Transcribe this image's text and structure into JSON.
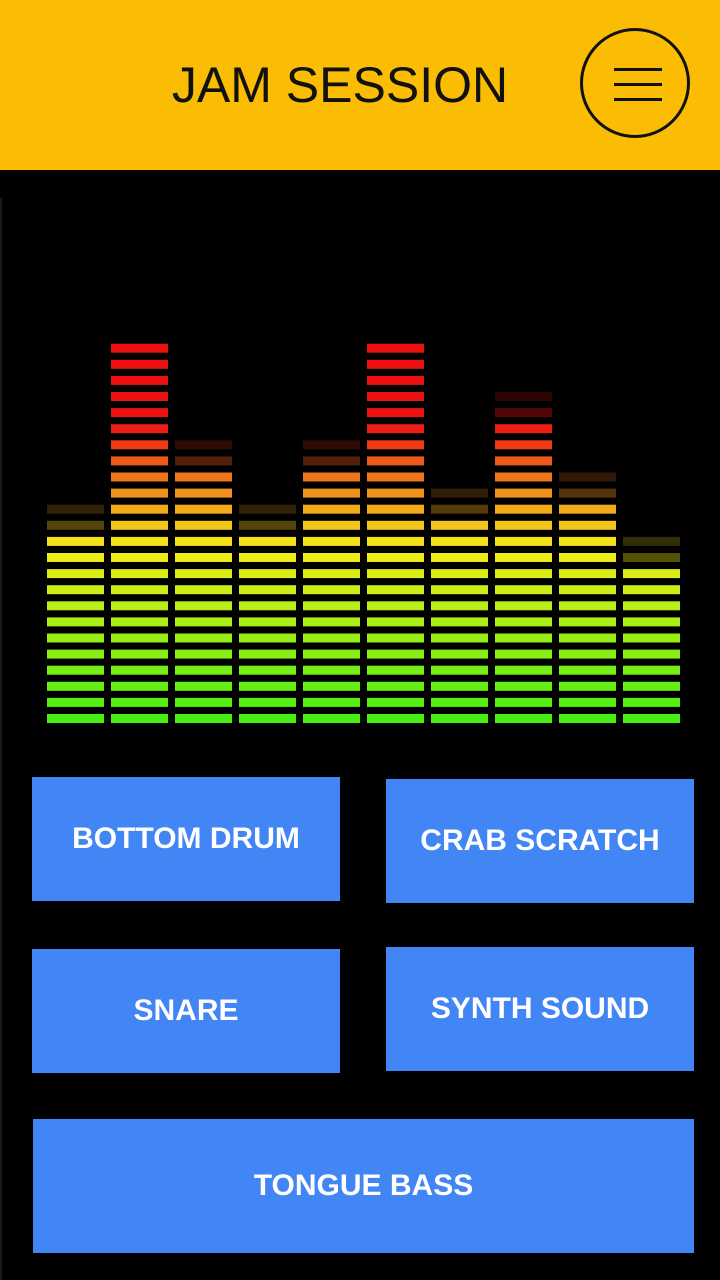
{
  "header": {
    "title": "JAM SESSION",
    "menu_icon": "hamburger-menu-icon",
    "background": "#FBBC04"
  },
  "visualizer": {
    "segments_per_column": 24,
    "levels": [
      12,
      24,
      16,
      12,
      16,
      24,
      13,
      19,
      14,
      10
    ],
    "colors": {
      "low": "#45F013",
      "mid": "#F6EC16",
      "orange": "#F08A1E",
      "high": "#EC1212"
    }
  },
  "buttons": {
    "bottom_drum": "BOTTOM DRUM",
    "crab_scratch": "CRAB SCRATCH",
    "snare": "SNARE",
    "synth_sound": "SYNTH SOUND",
    "tongue_bass": "TONGUE BASS",
    "color": "#4285F4"
  }
}
